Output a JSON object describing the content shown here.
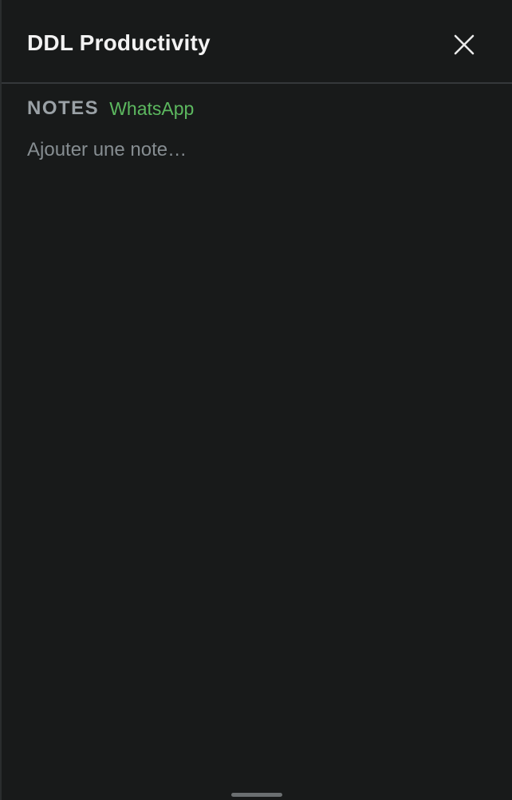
{
  "header": {
    "title": "DDL Productivity",
    "close_icon": "close-icon"
  },
  "notes": {
    "section_label": "NOTES",
    "app_tag": "WhatsApp",
    "input_value": "",
    "input_placeholder": "Ajouter une note…"
  },
  "colors": {
    "panel_background": "#181a1a",
    "accent_green": "#5cb85f",
    "label_gray": "#9aa1a6"
  }
}
